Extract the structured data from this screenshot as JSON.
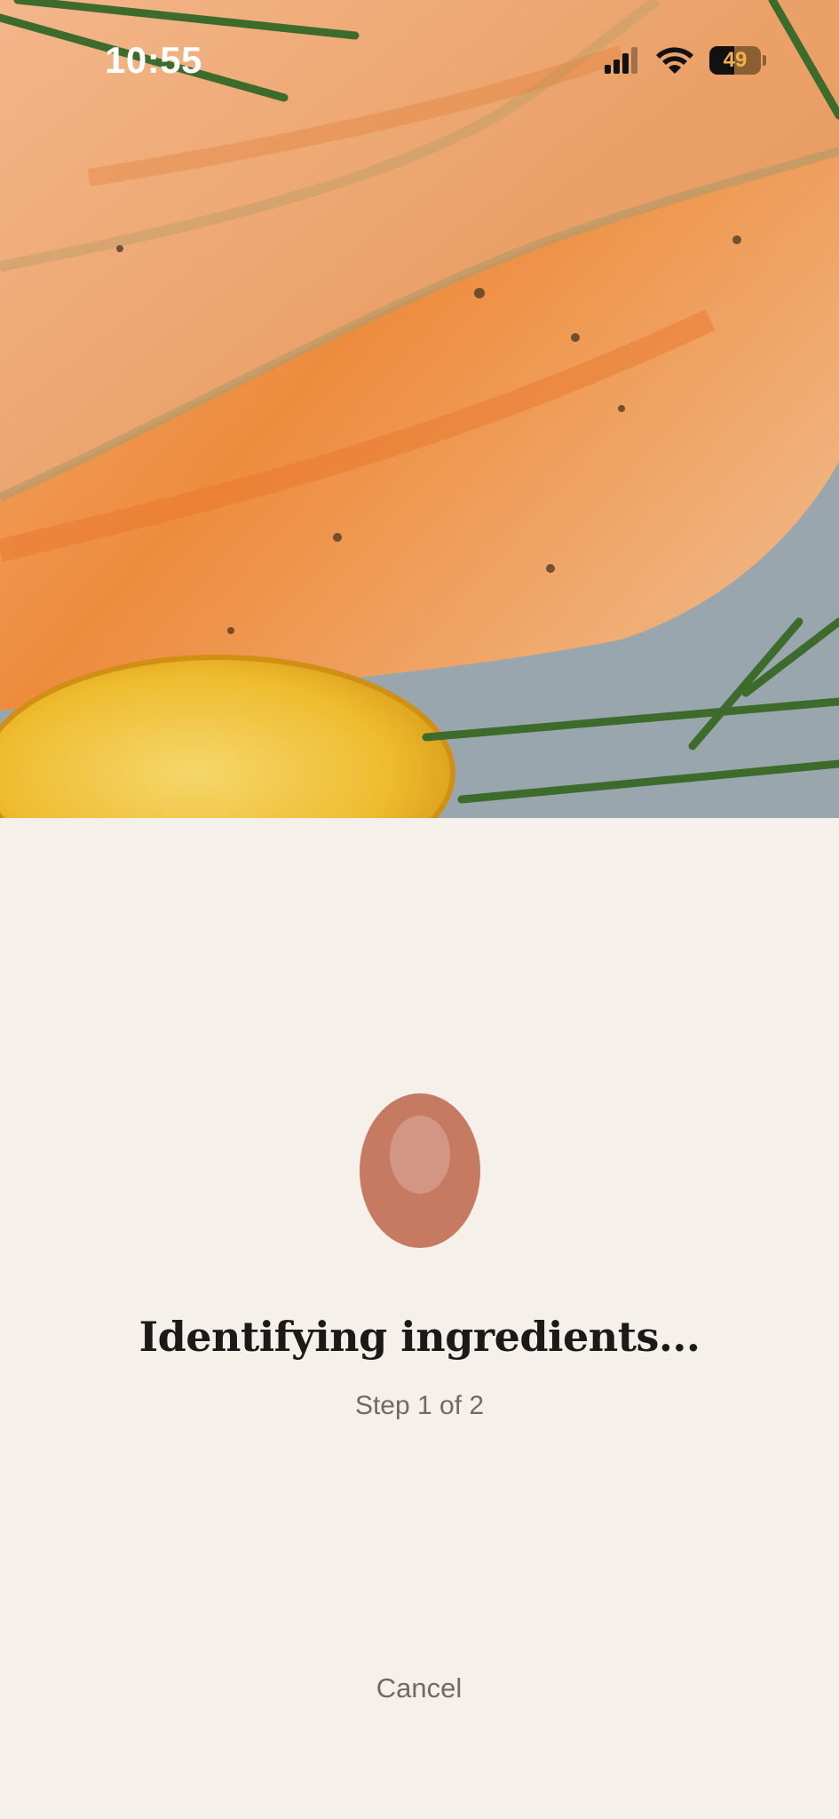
{
  "status_bar": {
    "time": "10:55",
    "battery_level": "49",
    "battery_fraction": 0.49
  },
  "hero": {
    "icon": "food-photo-salmon"
  },
  "loading": {
    "title": "Identifying ingredients...",
    "step": "Step 1 of 2",
    "indicator_color": "#c67a62"
  },
  "actions": {
    "cancel_label": "Cancel"
  },
  "colors": {
    "background": "#f5f1ea",
    "accent": "#c67a62"
  }
}
